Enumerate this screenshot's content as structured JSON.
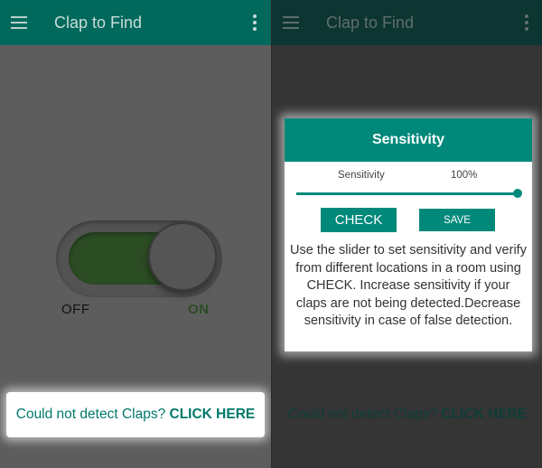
{
  "app": {
    "title": "Clap to Find"
  },
  "icons": {
    "menu": "hamburger-menu-icon",
    "overflow": "more-vertical-icon"
  },
  "colors": {
    "primary": "#00897b",
    "dark_primary": "#00695c",
    "switch_on": "#2c4c24"
  },
  "toggle": {
    "off_label": "OFF",
    "on_label": "ON",
    "state": "on"
  },
  "help": {
    "prefix": "Could not detect Claps? ",
    "cta": "CLICK HERE"
  },
  "dialog": {
    "title": "Sensitivity",
    "slider_label": "Sensitivity",
    "slider_value_text": "100%",
    "slider_value": 100,
    "check_label": "CHECK",
    "save_label": "SAVE",
    "instructions": "Use the slider to set sensitivity and verify from different locations in a room using CHECK. Increase sensitivity if your claps are not being detected.Decrease sensitivity in case of false detection."
  }
}
